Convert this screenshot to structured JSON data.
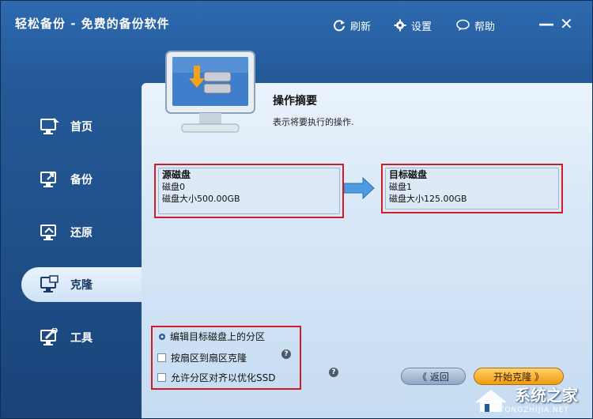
{
  "window": {
    "title": "轻松备份 - 免费的备份软件",
    "refresh_label": "刷新",
    "settings_label": "设置",
    "help_label": "帮助",
    "minimize": "—",
    "close": "✕"
  },
  "sidebar": {
    "items": [
      {
        "label": "首页",
        "icon": "home-monitor-icon"
      },
      {
        "label": "备份",
        "icon": "backup-monitor-icon"
      },
      {
        "label": "还原",
        "icon": "restore-monitor-icon"
      },
      {
        "label": "克隆",
        "icon": "clone-monitor-icon",
        "active": true
      },
      {
        "label": "工具",
        "icon": "tools-icon"
      }
    ]
  },
  "summary": {
    "title": "操作摘要",
    "description": "表示将要执行的操作."
  },
  "source_disk": {
    "heading": "源磁盘",
    "name": "磁盘0",
    "size": "磁盘大小500.00GB"
  },
  "target_disk": {
    "heading": "目标磁盘",
    "name": "磁盘1",
    "size": "磁盘大小125.00GB"
  },
  "options": {
    "edit_partitions": "编辑目标磁盘上的分区",
    "sector_clone": "按扇区到扇区克隆",
    "align_ssd": "允许分区对齐以优化SSD",
    "help_mark": "?"
  },
  "buttons": {
    "back": "《 返回",
    "start": "开始克隆 》"
  },
  "watermark": {
    "text": "系统之家",
    "sub": "XITONGZHIJIA.NET"
  },
  "colors": {
    "accent_blue": "#245a99",
    "highlight_red": "#d01c24",
    "start_orange": "#f09a12"
  }
}
